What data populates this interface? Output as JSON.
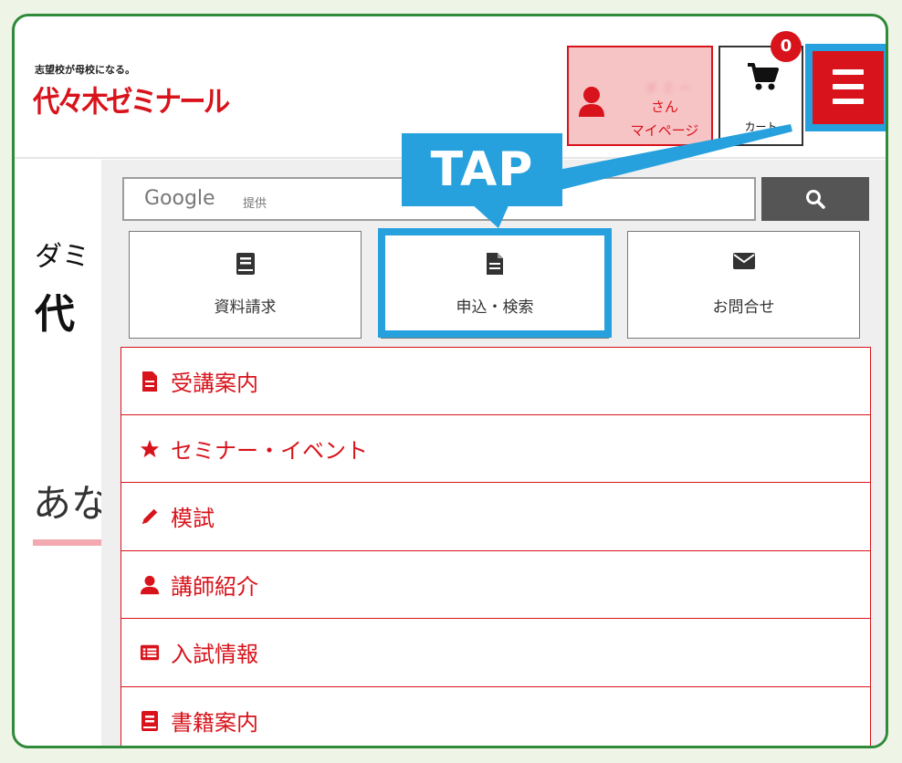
{
  "header": {
    "tagline": "志望校が母校になる。",
    "logo": "代々木ゼミナール",
    "mypage": {
      "name_blur": "ダミー",
      "suffix": "さん",
      "label": "マイページ"
    },
    "cart": {
      "label": "カート",
      "count": "0"
    }
  },
  "background_page": {
    "line1": "ダミ",
    "line2": "代",
    "line3": "あな"
  },
  "search": {
    "label": "Google",
    "label_suffix": "提供"
  },
  "quick_buttons": [
    {
      "label": "資料請求",
      "icon": "book-icon"
    },
    {
      "label": "申込・検索",
      "icon": "document-icon"
    },
    {
      "label": "お問合せ",
      "icon": "envelope-icon"
    }
  ],
  "menu_items": [
    {
      "label": "受講案内",
      "icon": "document-icon"
    },
    {
      "label": "セミナー・イベント",
      "icon": "star-icon"
    },
    {
      "label": "模試",
      "icon": "pencil-icon"
    },
    {
      "label": "講師紹介",
      "icon": "person-icon"
    },
    {
      "label": "入試情報",
      "icon": "list-icon"
    },
    {
      "label": "書籍案内",
      "icon": "book-icon"
    }
  ],
  "annotation": {
    "label": "TAP"
  },
  "colors": {
    "brand_red": "#d8131b",
    "highlight_blue": "#26a1dd",
    "frame_green": "#2f8a3a"
  }
}
